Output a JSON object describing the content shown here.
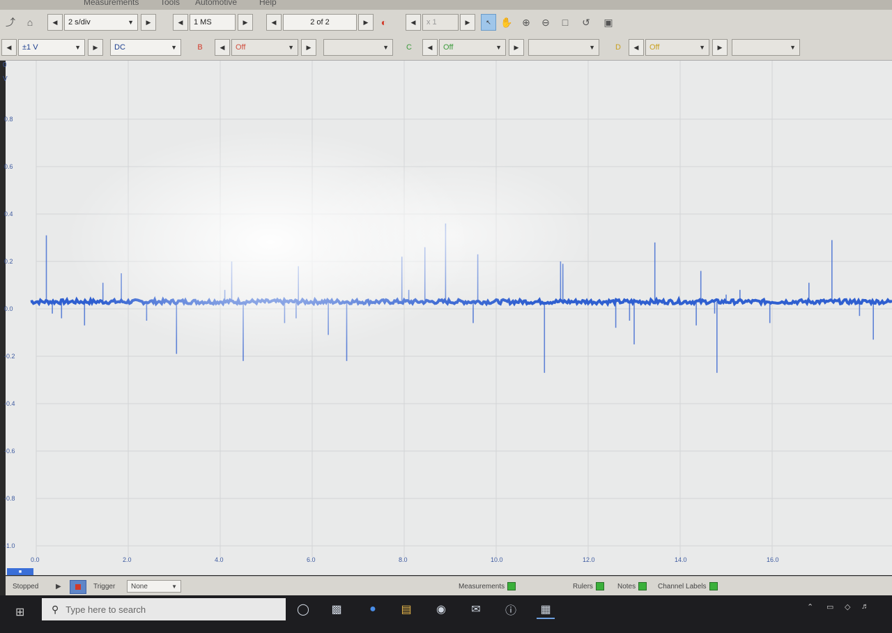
{
  "menu": {
    "items": [
      "Measurements",
      "Tools",
      "Automotive",
      "Help"
    ]
  },
  "toolbar1": {
    "timebase": "2 s/div",
    "samples": "1 MS",
    "buffer": "2 of 2",
    "zoom": "x 1"
  },
  "toolbar2": {
    "range": "±1 V",
    "coupling": "DC",
    "channel_b": "B",
    "channel_b_range": "Off",
    "channel_c": "C",
    "channel_c_range": "Off",
    "channel_d": "D",
    "channel_d_range": "Off"
  },
  "plot": {
    "y_unit_top": "0",
    "y_unit": "V",
    "trace_color": "#2f5fd0"
  },
  "chart_data": {
    "type": "line",
    "title": "",
    "xlabel": "",
    "ylabel": "V",
    "ylim": [
      -1.0,
      1.0
    ],
    "xlim": [
      0,
      18
    ],
    "y_ticks": [
      "0.8",
      "0.6",
      "0.4",
      "0.2",
      "0.0",
      "-0.2",
      "-0.4",
      "-0.6",
      "-0.8",
      "-1.0"
    ],
    "x_ticks": [
      "0.0",
      "2.0",
      "4.0",
      "6.0",
      "8.0",
      "10.0",
      "12.0",
      "14.0",
      "16.0"
    ],
    "grid": true,
    "series": [
      {
        "baseline": 0.03,
        "spikes": [
          {
            "x": 0.22,
            "y": 0.31
          },
          {
            "x": 0.35,
            "y": -0.02
          },
          {
            "x": 0.55,
            "y": -0.04
          },
          {
            "x": 1.05,
            "y": -0.07
          },
          {
            "x": 1.45,
            "y": 0.11
          },
          {
            "x": 1.85,
            "y": 0.15
          },
          {
            "x": 2.4,
            "y": -0.05
          },
          {
            "x": 3.05,
            "y": -0.19
          },
          {
            "x": 4.1,
            "y": 0.08
          },
          {
            "x": 4.25,
            "y": 0.2
          },
          {
            "x": 4.5,
            "y": -0.22
          },
          {
            "x": 5.4,
            "y": -0.06
          },
          {
            "x": 5.7,
            "y": 0.18
          },
          {
            "x": 5.65,
            "y": -0.04
          },
          {
            "x": 6.35,
            "y": -0.11
          },
          {
            "x": 6.75,
            "y": -0.22
          },
          {
            "x": 7.95,
            "y": 0.22
          },
          {
            "x": 8.1,
            "y": 0.08
          },
          {
            "x": 8.45,
            "y": 0.26
          },
          {
            "x": 8.9,
            "y": 0.36
          },
          {
            "x": 9.5,
            "y": -0.06
          },
          {
            "x": 9.6,
            "y": 0.23
          },
          {
            "x": 11.05,
            "y": -0.27
          },
          {
            "x": 11.4,
            "y": 0.2
          },
          {
            "x": 11.45,
            "y": 0.19
          },
          {
            "x": 12.6,
            "y": -0.08
          },
          {
            "x": 12.9,
            "y": -0.05
          },
          {
            "x": 13.0,
            "y": -0.15
          },
          {
            "x": 13.45,
            "y": 0.28
          },
          {
            "x": 14.35,
            "y": -0.07
          },
          {
            "x": 14.45,
            "y": 0.16
          },
          {
            "x": 14.75,
            "y": -0.02
          },
          {
            "x": 14.8,
            "y": -0.27
          },
          {
            "x": 15.0,
            "y": 0.06
          },
          {
            "x": 15.3,
            "y": 0.08
          },
          {
            "x": 15.95,
            "y": -0.06
          },
          {
            "x": 16.8,
            "y": 0.11
          },
          {
            "x": 17.3,
            "y": 0.29
          },
          {
            "x": 17.9,
            "y": -0.03
          },
          {
            "x": 18.2,
            "y": -0.13
          }
        ]
      }
    ]
  },
  "status": {
    "state": "Stopped",
    "trigger_label": "Trigger",
    "trigger_value": "None",
    "measurements": "Measurements",
    "rulers": "Rulers",
    "notes": "Notes",
    "channel_labels": "Channel Labels"
  },
  "taskbar": {
    "search_placeholder": "Type here to search"
  }
}
